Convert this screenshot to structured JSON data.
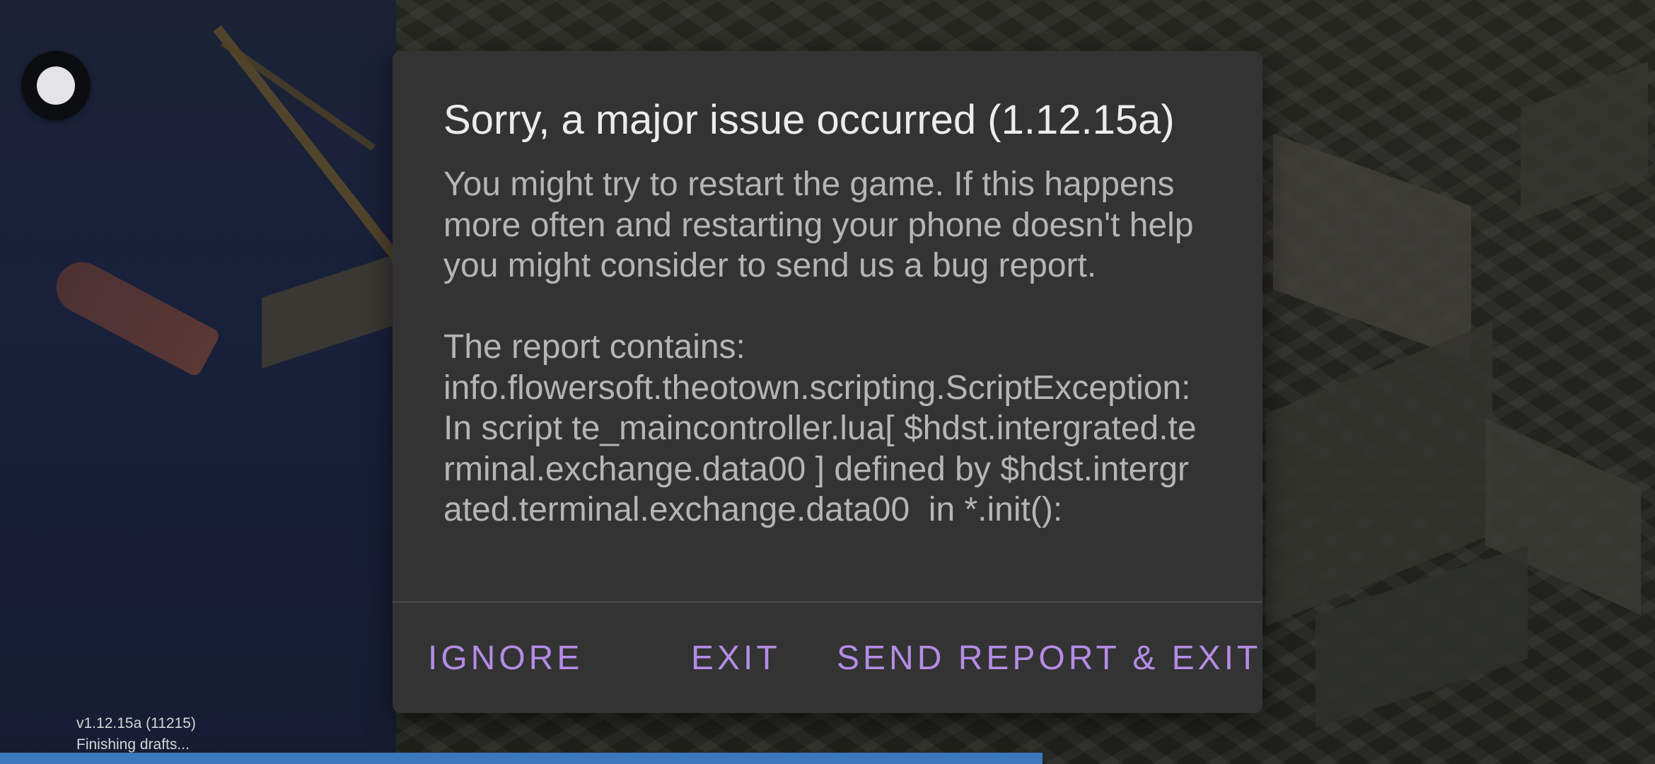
{
  "dialog": {
    "title": "Sorry, a major issue occurred (1.12.15a)",
    "message": "You might try to restart the game. If this happens more often and restarting your phone doesn't help you might consider to send us a bug report.\n\nThe report contains:\ninfo.flowersoft.theotown.scripting.ScriptException: In script te_maincontroller.lua[ $hdst.intergrated.terminal.exchange.data00 ] defined by $hdst.intergrated.terminal.exchange.data00  in *.init():",
    "buttons": {
      "ignore": "IGNORE",
      "exit": "EXIT",
      "send": "SEND REPORT & EXIT"
    },
    "button_color": "#b48ce6"
  },
  "status": {
    "version": "v1.12.15a (11215)",
    "message": "Finishing drafts...",
    "progress": 0.63,
    "progress_color": "#3d78bf"
  },
  "fab": {
    "icon": "circle-icon"
  }
}
